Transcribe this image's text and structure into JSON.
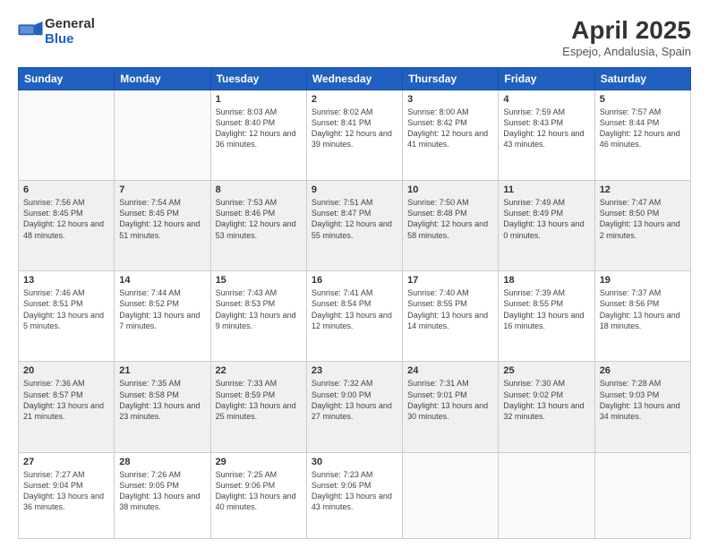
{
  "header": {
    "logo_general": "General",
    "logo_blue": "Blue",
    "title": "April 2025",
    "subtitle": "Espejo, Andalusia, Spain"
  },
  "days_of_week": [
    "Sunday",
    "Monday",
    "Tuesday",
    "Wednesday",
    "Thursday",
    "Friday",
    "Saturday"
  ],
  "weeks": [
    [
      {
        "day": "",
        "info": ""
      },
      {
        "day": "",
        "info": ""
      },
      {
        "day": "1",
        "info": "Sunrise: 8:03 AM\nSunset: 8:40 PM\nDaylight: 12 hours and 36 minutes."
      },
      {
        "day": "2",
        "info": "Sunrise: 8:02 AM\nSunset: 8:41 PM\nDaylight: 12 hours and 39 minutes."
      },
      {
        "day": "3",
        "info": "Sunrise: 8:00 AM\nSunset: 8:42 PM\nDaylight: 12 hours and 41 minutes."
      },
      {
        "day": "4",
        "info": "Sunrise: 7:59 AM\nSunset: 8:43 PM\nDaylight: 12 hours and 43 minutes."
      },
      {
        "day": "5",
        "info": "Sunrise: 7:57 AM\nSunset: 8:44 PM\nDaylight: 12 hours and 46 minutes."
      }
    ],
    [
      {
        "day": "6",
        "info": "Sunrise: 7:56 AM\nSunset: 8:45 PM\nDaylight: 12 hours and 48 minutes."
      },
      {
        "day": "7",
        "info": "Sunrise: 7:54 AM\nSunset: 8:45 PM\nDaylight: 12 hours and 51 minutes."
      },
      {
        "day": "8",
        "info": "Sunrise: 7:53 AM\nSunset: 8:46 PM\nDaylight: 12 hours and 53 minutes."
      },
      {
        "day": "9",
        "info": "Sunrise: 7:51 AM\nSunset: 8:47 PM\nDaylight: 12 hours and 55 minutes."
      },
      {
        "day": "10",
        "info": "Sunrise: 7:50 AM\nSunset: 8:48 PM\nDaylight: 12 hours and 58 minutes."
      },
      {
        "day": "11",
        "info": "Sunrise: 7:49 AM\nSunset: 8:49 PM\nDaylight: 13 hours and 0 minutes."
      },
      {
        "day": "12",
        "info": "Sunrise: 7:47 AM\nSunset: 8:50 PM\nDaylight: 13 hours and 2 minutes."
      }
    ],
    [
      {
        "day": "13",
        "info": "Sunrise: 7:46 AM\nSunset: 8:51 PM\nDaylight: 13 hours and 5 minutes."
      },
      {
        "day": "14",
        "info": "Sunrise: 7:44 AM\nSunset: 8:52 PM\nDaylight: 13 hours and 7 minutes."
      },
      {
        "day": "15",
        "info": "Sunrise: 7:43 AM\nSunset: 8:53 PM\nDaylight: 13 hours and 9 minutes."
      },
      {
        "day": "16",
        "info": "Sunrise: 7:41 AM\nSunset: 8:54 PM\nDaylight: 13 hours and 12 minutes."
      },
      {
        "day": "17",
        "info": "Sunrise: 7:40 AM\nSunset: 8:55 PM\nDaylight: 13 hours and 14 minutes."
      },
      {
        "day": "18",
        "info": "Sunrise: 7:39 AM\nSunset: 8:55 PM\nDaylight: 13 hours and 16 minutes."
      },
      {
        "day": "19",
        "info": "Sunrise: 7:37 AM\nSunset: 8:56 PM\nDaylight: 13 hours and 18 minutes."
      }
    ],
    [
      {
        "day": "20",
        "info": "Sunrise: 7:36 AM\nSunset: 8:57 PM\nDaylight: 13 hours and 21 minutes."
      },
      {
        "day": "21",
        "info": "Sunrise: 7:35 AM\nSunset: 8:58 PM\nDaylight: 13 hours and 23 minutes."
      },
      {
        "day": "22",
        "info": "Sunrise: 7:33 AM\nSunset: 8:59 PM\nDaylight: 13 hours and 25 minutes."
      },
      {
        "day": "23",
        "info": "Sunrise: 7:32 AM\nSunset: 9:00 PM\nDaylight: 13 hours and 27 minutes."
      },
      {
        "day": "24",
        "info": "Sunrise: 7:31 AM\nSunset: 9:01 PM\nDaylight: 13 hours and 30 minutes."
      },
      {
        "day": "25",
        "info": "Sunrise: 7:30 AM\nSunset: 9:02 PM\nDaylight: 13 hours and 32 minutes."
      },
      {
        "day": "26",
        "info": "Sunrise: 7:28 AM\nSunset: 9:03 PM\nDaylight: 13 hours and 34 minutes."
      }
    ],
    [
      {
        "day": "27",
        "info": "Sunrise: 7:27 AM\nSunset: 9:04 PM\nDaylight: 13 hours and 36 minutes."
      },
      {
        "day": "28",
        "info": "Sunrise: 7:26 AM\nSunset: 9:05 PM\nDaylight: 13 hours and 38 minutes."
      },
      {
        "day": "29",
        "info": "Sunrise: 7:25 AM\nSunset: 9:06 PM\nDaylight: 13 hours and 40 minutes."
      },
      {
        "day": "30",
        "info": "Sunrise: 7:23 AM\nSunset: 9:06 PM\nDaylight: 13 hours and 43 minutes."
      },
      {
        "day": "",
        "info": ""
      },
      {
        "day": "",
        "info": ""
      },
      {
        "day": "",
        "info": ""
      }
    ]
  ]
}
